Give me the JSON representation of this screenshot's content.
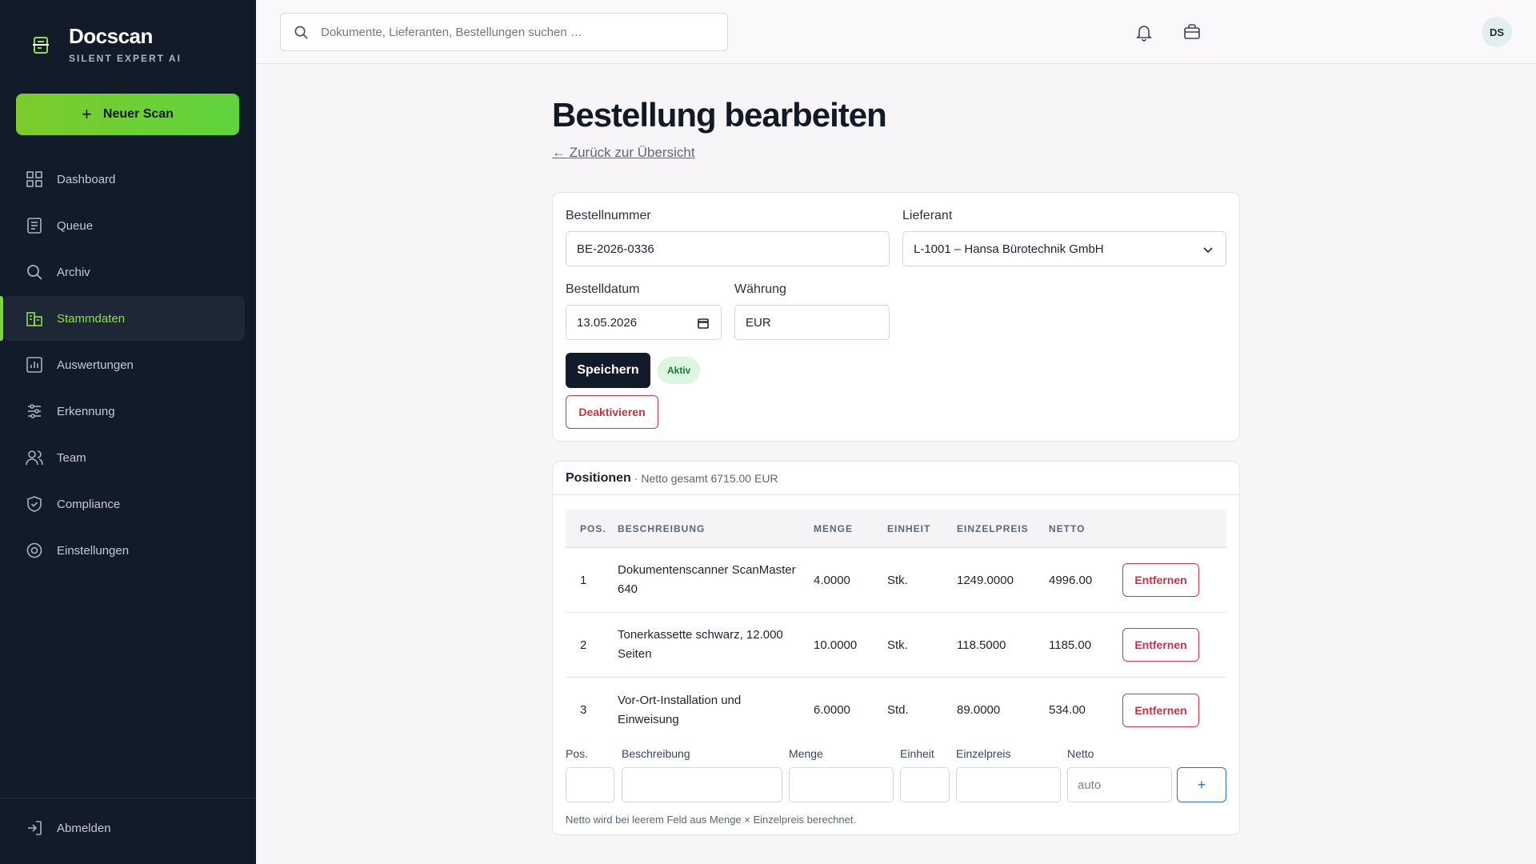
{
  "brand": {
    "name": "Docscan",
    "subtitle": "SILENT EXPERT AI"
  },
  "sidebar": {
    "new_scan_label": "Neuer Scan",
    "items": [
      {
        "label": "Dashboard",
        "icon": "grid-icon"
      },
      {
        "label": "Queue",
        "icon": "list-icon"
      },
      {
        "label": "Archiv",
        "icon": "search-icon"
      },
      {
        "label": "Stammdaten",
        "icon": "building-icon",
        "active": true
      },
      {
        "label": "Auswertungen",
        "icon": "bar-chart-icon"
      },
      {
        "label": "Erkennung",
        "icon": "sliders-icon"
      },
      {
        "label": "Team",
        "icon": "users-icon"
      },
      {
        "label": "Compliance",
        "icon": "shield-icon"
      },
      {
        "label": "Einstellungen",
        "icon": "gear-icon"
      }
    ],
    "logout_label": "Abmelden"
  },
  "topbar": {
    "search_placeholder": "Dokumente, Lieferanten, Bestellungen suchen …",
    "avatar_initials": "DS"
  },
  "page": {
    "title": "Bestellung bearbeiten",
    "back_link": "← Zurück zur Übersicht"
  },
  "form": {
    "order_number_label": "Bestellnummer",
    "order_number": "BE-2026-0336",
    "supplier_label": "Lieferant",
    "supplier": "L-1001 – Hansa Bürotechnik GmbH",
    "date_label": "Bestelldatum",
    "date": "13.05.2026",
    "currency_label": "Währung",
    "currency": "EUR",
    "save_label": "Speichern",
    "status_badge": "Aktiv",
    "deactivate_label": "Deaktivieren"
  },
  "positions": {
    "title": "Positionen",
    "net_total": "· Netto gesamt 6715.00 EUR",
    "columns": [
      "POS.",
      "BESCHREIBUNG",
      "MENGE",
      "EINHEIT",
      "EINZELPREIS",
      "NETTO"
    ],
    "rows": [
      {
        "pos": "1",
        "desc": "Dokumentenscanner ScanMaster 640",
        "qty": "4.0000",
        "unit": "Stk.",
        "price": "1249.0000",
        "net": "4996.00"
      },
      {
        "pos": "2",
        "desc": "Tonerkassette schwarz, 12.000 Seiten",
        "qty": "10.0000",
        "unit": "Stk.",
        "price": "118.5000",
        "net": "1185.00"
      },
      {
        "pos": "3",
        "desc": "Vor-Ort-Installation und Einweisung",
        "qty": "6.0000",
        "unit": "Std.",
        "price": "89.0000",
        "net": "534.00"
      }
    ],
    "remove_label": "Entfernen",
    "add_labels": {
      "pos": "Pos.",
      "desc": "Beschreibung",
      "qty": "Menge",
      "unit": "Einheit",
      "price": "Einzelpreis",
      "net": "Netto"
    },
    "net_placeholder": "auto",
    "add_button": "+",
    "hint": "Netto wird bei leerem Feld aus Menge × Einzelpreis berechnet."
  },
  "colors": {
    "sidebar_bg": "#121b2a",
    "accent_green": "#7ed43a",
    "danger": "#c0344a",
    "primary_dark": "#131b2a",
    "link_blue": "#2f6ec4"
  }
}
